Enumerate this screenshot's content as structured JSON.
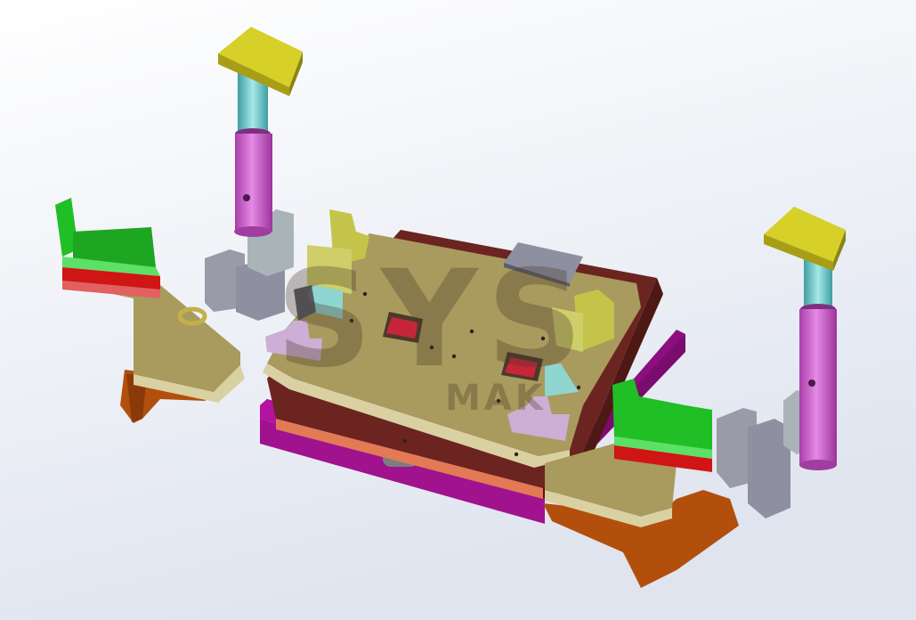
{
  "watermark": {
    "main_text": "SYS",
    "sub_text": "MAK"
  },
  "colors": {
    "background_top": "#ffffff",
    "background_bottom": "#dfe4ef",
    "plate_tan": "#a99a5e",
    "plate_maroon": "#6b2420",
    "plate_magenta": "#b3139f",
    "bracket_orange": "#b24f0c",
    "clamp_green": "#1fbf25",
    "pad_red": "#d01515",
    "cylinder_pink": "#d65ed6",
    "rod_cyan": "#6cc7c9",
    "pad_yellow": "#d6d028",
    "block_grey": "#9a9ba8",
    "support_lilac": "#cdaed4"
  }
}
